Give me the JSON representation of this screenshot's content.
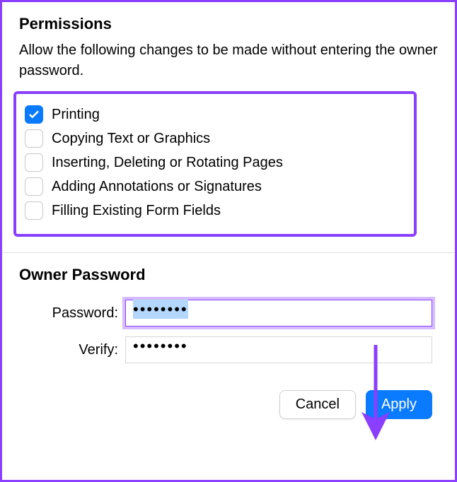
{
  "permissions": {
    "title": "Permissions",
    "description": "Allow the following changes to be made without entering the owner password.",
    "items": [
      {
        "label": "Printing",
        "checked": true
      },
      {
        "label": "Copying Text or Graphics",
        "checked": false
      },
      {
        "label": "Inserting, Deleting or Rotating Pages",
        "checked": false
      },
      {
        "label": "Adding Annotations or Signatures",
        "checked": false
      },
      {
        "label": "Filling Existing Form Fields",
        "checked": false
      }
    ]
  },
  "owner": {
    "title": "Owner Password",
    "password_label": "Password:",
    "verify_label": "Verify:",
    "password_value": "••••••••",
    "verify_value": "••••••••"
  },
  "buttons": {
    "cancel": "Cancel",
    "apply": "Apply"
  },
  "colors": {
    "accent": "#0a7aff",
    "highlight": "#8a3fff"
  }
}
